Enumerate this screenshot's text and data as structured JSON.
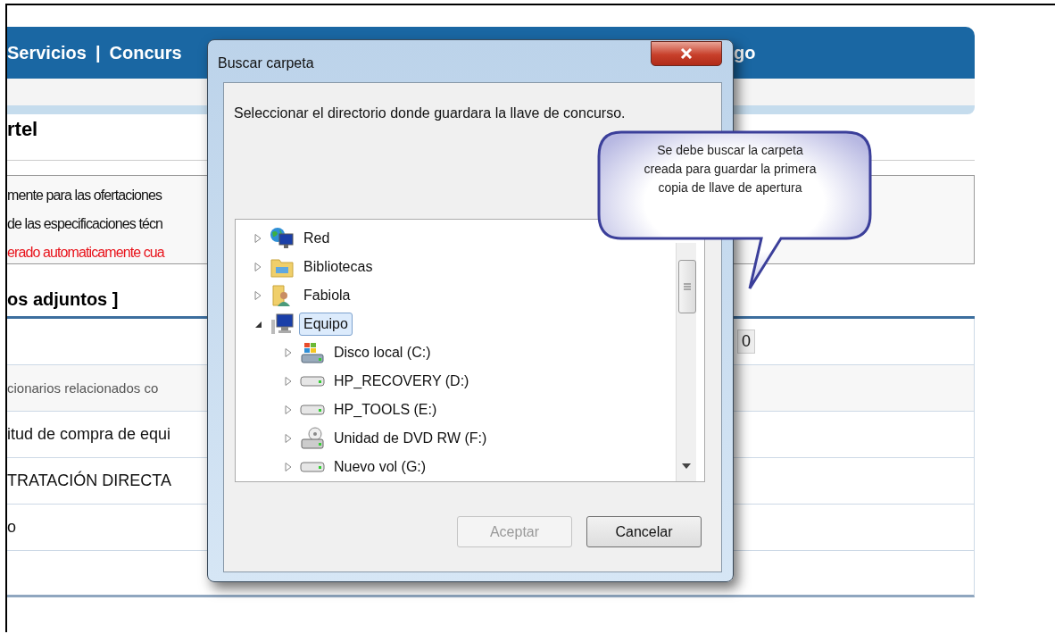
{
  "nav": {
    "items": [
      {
        "label": "Servicios"
      },
      {
        "label": "Concurs"
      }
    ],
    "separator": "|",
    "trailing": "go"
  },
  "page": {
    "heading": "rtel",
    "notes": [
      {
        "text": "mente para las ofertaciones",
        "kind": "normal"
      },
      {
        "text": "de las especificaciones técn",
        "kind": "normal"
      },
      {
        "text": "erado automaticamente cua",
        "kind": "warning"
      }
    ],
    "section_heading": "os adjuntos ]",
    "rows": [
      {
        "text": "",
        "value": "0"
      },
      {
        "text": "cionarios relacionados co",
        "kind": "note"
      },
      {
        "text": "itud de compra de equi"
      },
      {
        "text": "TRATACIÓN DIRECTA"
      },
      {
        "text": "o"
      },
      {
        "text": ""
      }
    ]
  },
  "dialog": {
    "title": "Buscar carpeta",
    "instruction": "Seleccionar el directorio donde guardara la llave de concurso.",
    "tree": [
      {
        "label": "Red",
        "kind": "network",
        "expanded": false,
        "selected": false
      },
      {
        "label": "Bibliotecas",
        "kind": "libraries",
        "expanded": false,
        "selected": false
      },
      {
        "label": "Fabiola",
        "kind": "user",
        "expanded": false,
        "selected": false
      },
      {
        "label": "Equipo",
        "kind": "computer",
        "expanded": true,
        "selected": true,
        "children": [
          {
            "label": "Disco local (C:)",
            "kind": "system-drive",
            "expanded": false,
            "selected": false
          },
          {
            "label": "HP_RECOVERY (D:)",
            "kind": "drive",
            "expanded": false,
            "selected": false
          },
          {
            "label": "HP_TOOLS (E:)",
            "kind": "drive",
            "expanded": false,
            "selected": false
          },
          {
            "label": "Unidad de DVD RW (F:)",
            "kind": "dvd-drive",
            "expanded": false,
            "selected": false
          },
          {
            "label": "Nuevo vol (G:)",
            "kind": "drive",
            "expanded": false,
            "selected": false
          }
        ]
      }
    ],
    "buttons": [
      {
        "label": "Aceptar",
        "disabled": true
      },
      {
        "label": "Cancelar",
        "disabled": false
      }
    ]
  },
  "callout": {
    "text": "Se debe buscar la carpeta creada para guardar la primera copia de llave de apertura"
  }
}
